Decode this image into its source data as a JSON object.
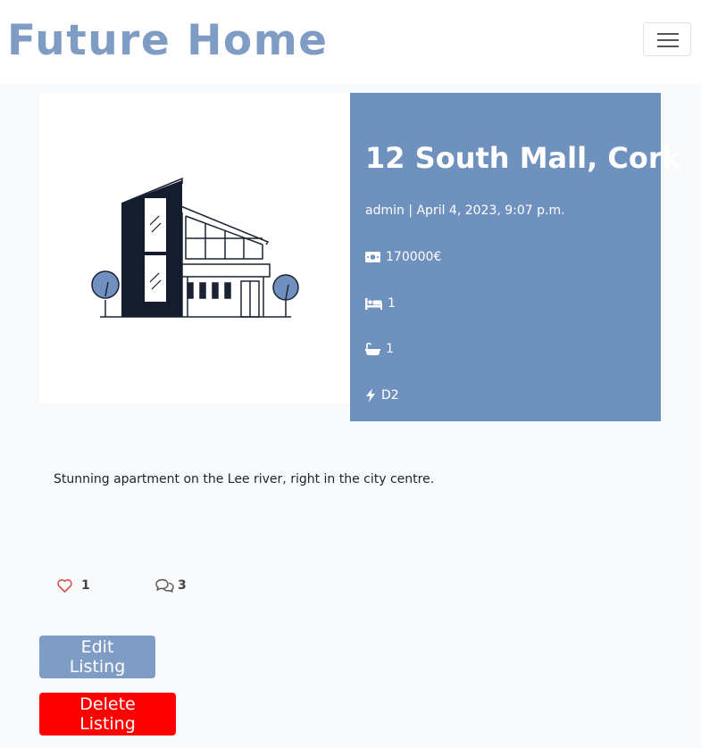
{
  "navbar": {
    "brand": "Future Home",
    "toggle_icon": "hamburger-menu-icon"
  },
  "listing": {
    "title": "12 South Mall, Cork",
    "meta": "admin | April 4, 2023, 9:07 p.m.",
    "price": "170000€",
    "bedrooms": "1",
    "bathrooms": "1",
    "energy_rating": "D2",
    "description": "Stunning apartment on the Lee river, right in the city centre.",
    "image_icon": "house-illustration"
  },
  "engagement": {
    "likes": "1",
    "comments": "3"
  },
  "actions": {
    "edit_label": "Edit Listing",
    "delete_label": "Delete Listing"
  },
  "colors": {
    "brand": "#7f9cc4",
    "panel": "#6f91bd",
    "delete": "#ff0000",
    "like_heart": "#d9534f"
  }
}
